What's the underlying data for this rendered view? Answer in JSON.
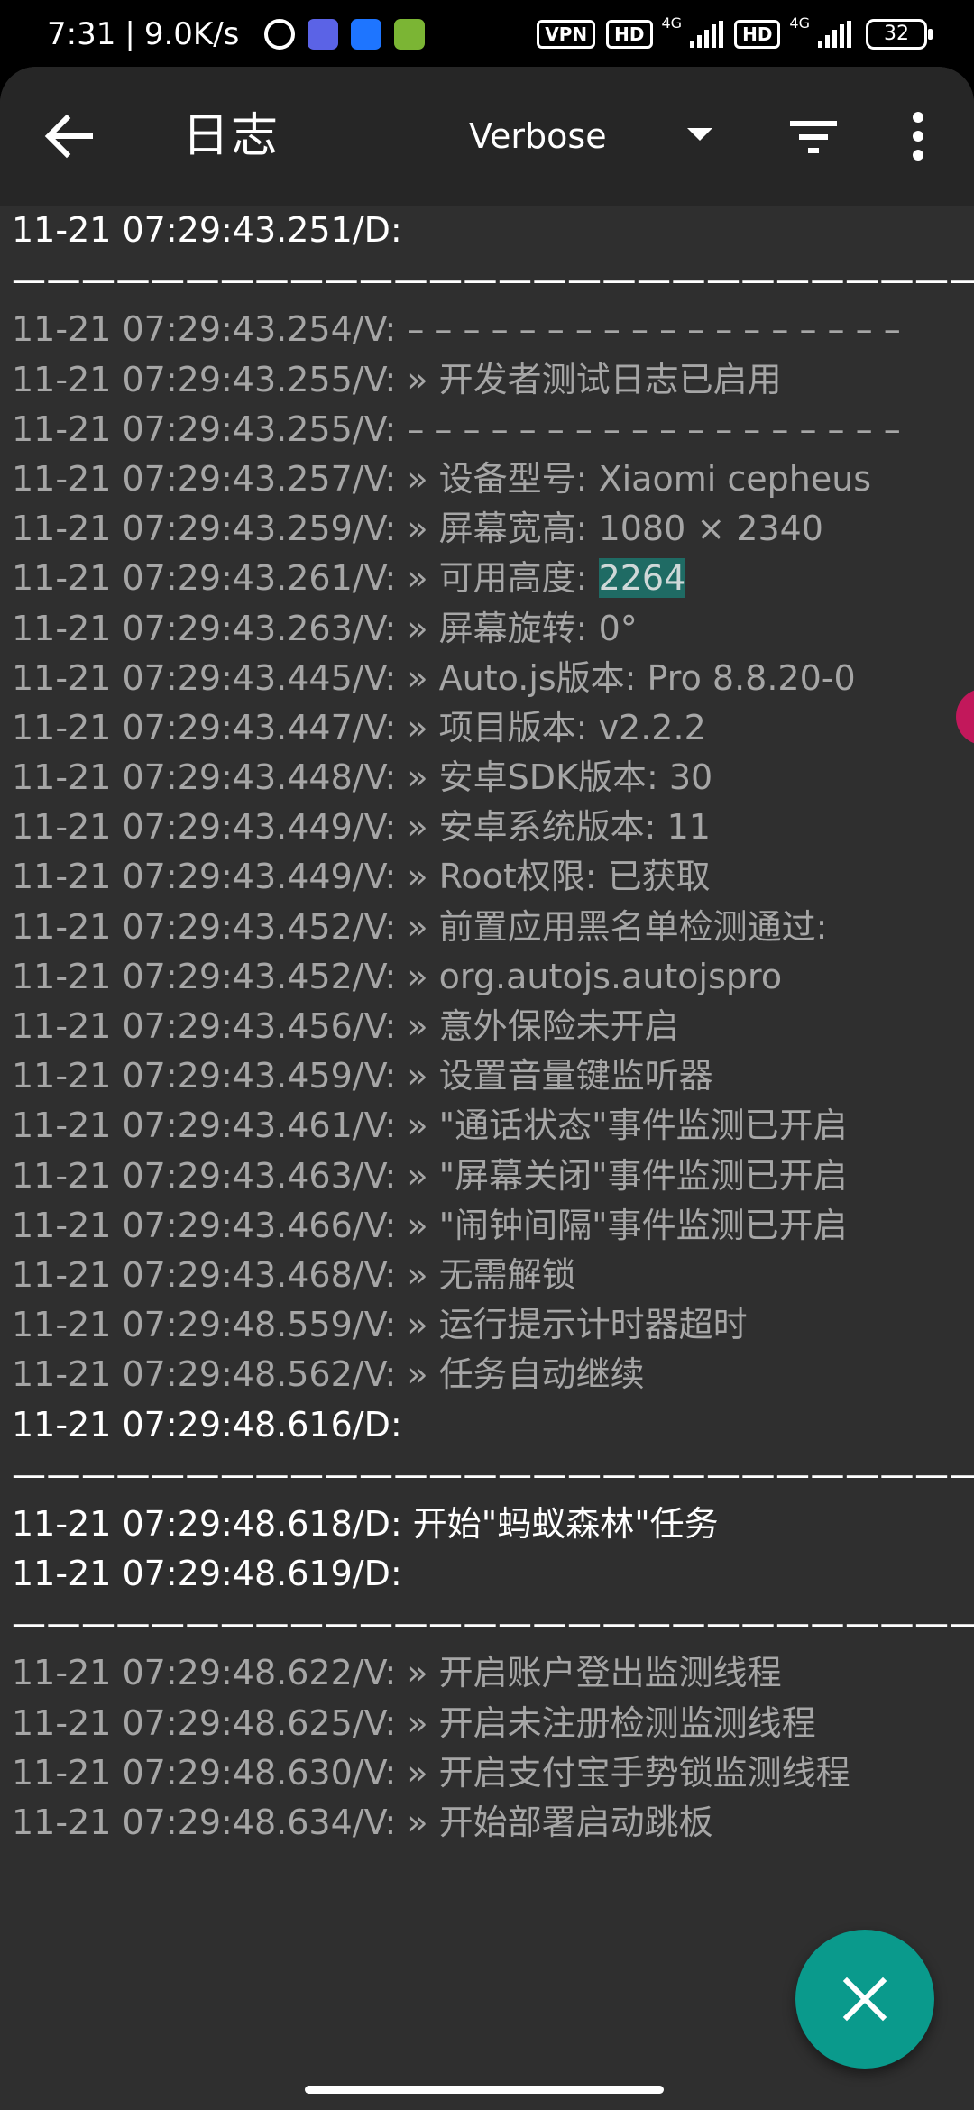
{
  "status_bar": {
    "time": "7:31",
    "separator": "|",
    "net_speed": "9.0K/s",
    "vpn_label": "VPN",
    "hd1_label": "HD",
    "net1_label": "4G",
    "hd2_label": "HD",
    "net2_label": "4G",
    "battery": "32"
  },
  "toolbar": {
    "title": "日志",
    "level": "Verbose",
    "back_icon": "arrow-left-icon",
    "filter_icon": "filter-icon",
    "more_icon": "more-vertical-icon"
  },
  "logs": [
    {
      "text": "11-21 07:29:43.251/D:",
      "level": "D"
    },
    {
      "text": "————————————————————————————",
      "level": "D",
      "sep": true
    },
    {
      "text": "11-21 07:29:43.254/V: – – – – – – – – – – – – – – – – – –",
      "level": "V"
    },
    {
      "text": "11-21 07:29:43.255/V: » 开发者测试日志已启用",
      "level": "V"
    },
    {
      "text": "11-21 07:29:43.255/V: – – – – – – – – – – – – – – – – – –",
      "level": "V"
    },
    {
      "text": "11-21 07:29:43.257/V: » 设备型号: Xiaomi cepheus",
      "level": "V"
    },
    {
      "text": "11-21 07:29:43.259/V: » 屏幕宽高: 1080 × 2340",
      "level": "V"
    },
    {
      "text": "11-21 07:29:43.261/V: » 可用高度: ",
      "level": "V",
      "highlight": "2264"
    },
    {
      "text": "11-21 07:29:43.263/V: » 屏幕旋转: 0°",
      "level": "V"
    },
    {
      "text": "11-21 07:29:43.445/V: » Auto.js版本: Pro 8.8.20-0",
      "level": "V"
    },
    {
      "text": "11-21 07:29:43.447/V: » 项目版本: v2.2.2",
      "level": "V"
    },
    {
      "text": "11-21 07:29:43.448/V: » 安卓SDK版本: 30",
      "level": "V"
    },
    {
      "text": "11-21 07:29:43.449/V: » 安卓系统版本: 11",
      "level": "V"
    },
    {
      "text": "11-21 07:29:43.449/V: » Root权限: 已获取",
      "level": "V"
    },
    {
      "text": "11-21 07:29:43.452/V: » 前置应用黑名单检测通过:",
      "level": "V"
    },
    {
      "text": "11-21 07:29:43.452/V: » org.autojs.autojspro",
      "level": "V"
    },
    {
      "text": "11-21 07:29:43.456/V: » 意外保险未开启",
      "level": "V"
    },
    {
      "text": "11-21 07:29:43.459/V: » 设置音量键监听器",
      "level": "V"
    },
    {
      "text": "11-21 07:29:43.461/V: » \"通话状态\"事件监测已开启",
      "level": "V"
    },
    {
      "text": "11-21 07:29:43.463/V: » \"屏幕关闭\"事件监测已开启",
      "level": "V"
    },
    {
      "text": "11-21 07:29:43.466/V: » \"闹钟间隔\"事件监测已开启",
      "level": "V"
    },
    {
      "text": "11-21 07:29:43.468/V: » 无需解锁",
      "level": "V"
    },
    {
      "text": "11-21 07:29:48.559/V: » 运行提示计时器超时",
      "level": "V"
    },
    {
      "text": "11-21 07:29:48.562/V: » 任务自动继续",
      "level": "V"
    },
    {
      "text": "11-21 07:29:48.616/D:",
      "level": "D"
    },
    {
      "text": "————————————————————————————",
      "level": "D",
      "sep": true
    },
    {
      "text": "11-21 07:29:48.618/D: 开始\"蚂蚁森林\"任务",
      "level": "D"
    },
    {
      "text": "11-21 07:29:48.619/D:",
      "level": "D"
    },
    {
      "text": "————————————————————————————",
      "level": "D",
      "sep": true
    },
    {
      "text": "11-21 07:29:48.622/V: » 开启账户登出监测线程",
      "level": "V"
    },
    {
      "text": "11-21 07:29:48.625/V: » 开启未注册检测监测线程",
      "level": "V"
    },
    {
      "text": "11-21 07:29:48.630/V: » 开启支付宝手势锁监测线程",
      "level": "V"
    },
    {
      "text": "11-21 07:29:48.634/V: » 开始部署启动跳板",
      "level": "V"
    }
  ],
  "fab": {
    "icon": "close-icon"
  },
  "colors": {
    "panel_bg": "#2f2f2f",
    "toolbar_bg": "#262626",
    "verbose_text": "#a6a6a6",
    "debug_text": "#ffffff",
    "highlight_bg": "#1f6b64",
    "fab_bg": "#0a9a8c"
  }
}
